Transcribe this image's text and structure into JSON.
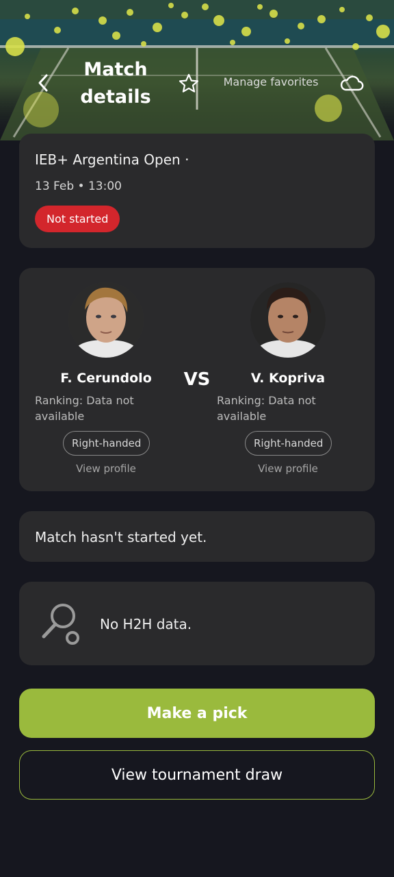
{
  "header": {
    "title": "Match details",
    "manage_favorites": "Manage favorites",
    "icons": {
      "back": "chevron-left-icon",
      "favorite": "star-icon",
      "weather": "cloud-icon"
    }
  },
  "tournament": {
    "name": "IEB+ Argentina Open ·",
    "datetime": "13 Feb • 13:00",
    "status": "Not started"
  },
  "players": {
    "vs": "VS",
    "left": {
      "name": "F. Cerundolo",
      "ranking": "Ranking: Data not available",
      "hand": "Right-handed",
      "profile_link": "View profile"
    },
    "right": {
      "name": "V. Kopriva",
      "ranking": "Ranking: Data not available",
      "hand": "Right-handed",
      "profile_link": "View profile"
    }
  },
  "match_status": "Match hasn't started yet.",
  "h2h": {
    "text": "No H2H data.",
    "icon": "tennis-racket-icon"
  },
  "actions": {
    "pick": "Make a pick",
    "draw": "View tournament draw"
  },
  "colors": {
    "background": "#16171f",
    "card": "#2a2a2c",
    "accent": "#9aba3d",
    "status_badge": "#d3262c"
  }
}
